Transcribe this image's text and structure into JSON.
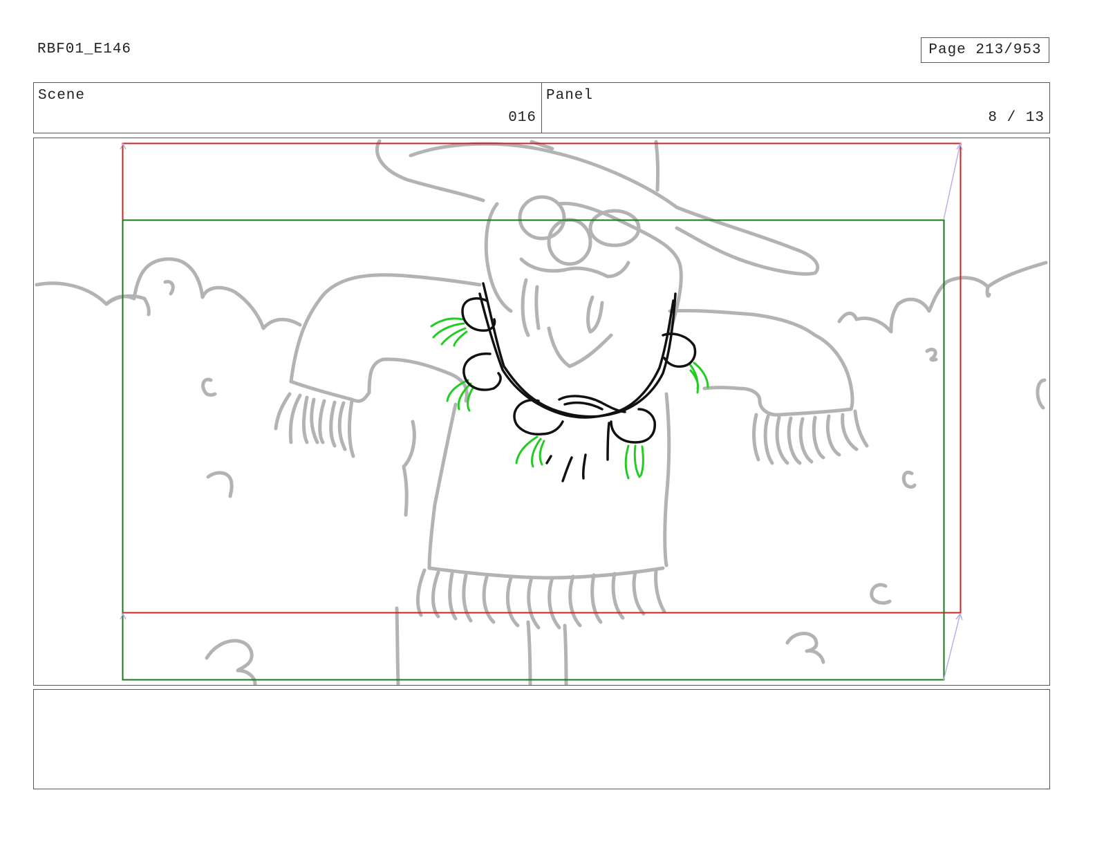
{
  "header": {
    "document_id": "RBF01_E146",
    "page": "Page 213/953"
  },
  "info": {
    "scene_label": "Scene",
    "scene_value": "016",
    "panel_label": "Panel",
    "panel_value": "8 / 13"
  },
  "colors": {
    "sketch_gray": "#b3b3b3",
    "ink_black": "#111111",
    "leaf_green": "#22cc22",
    "frame_red": "#cc2222",
    "frame_green": "#1a7a1a",
    "camera_move_lavender": "#b8b0e8"
  },
  "notes": {
    "text": ""
  }
}
